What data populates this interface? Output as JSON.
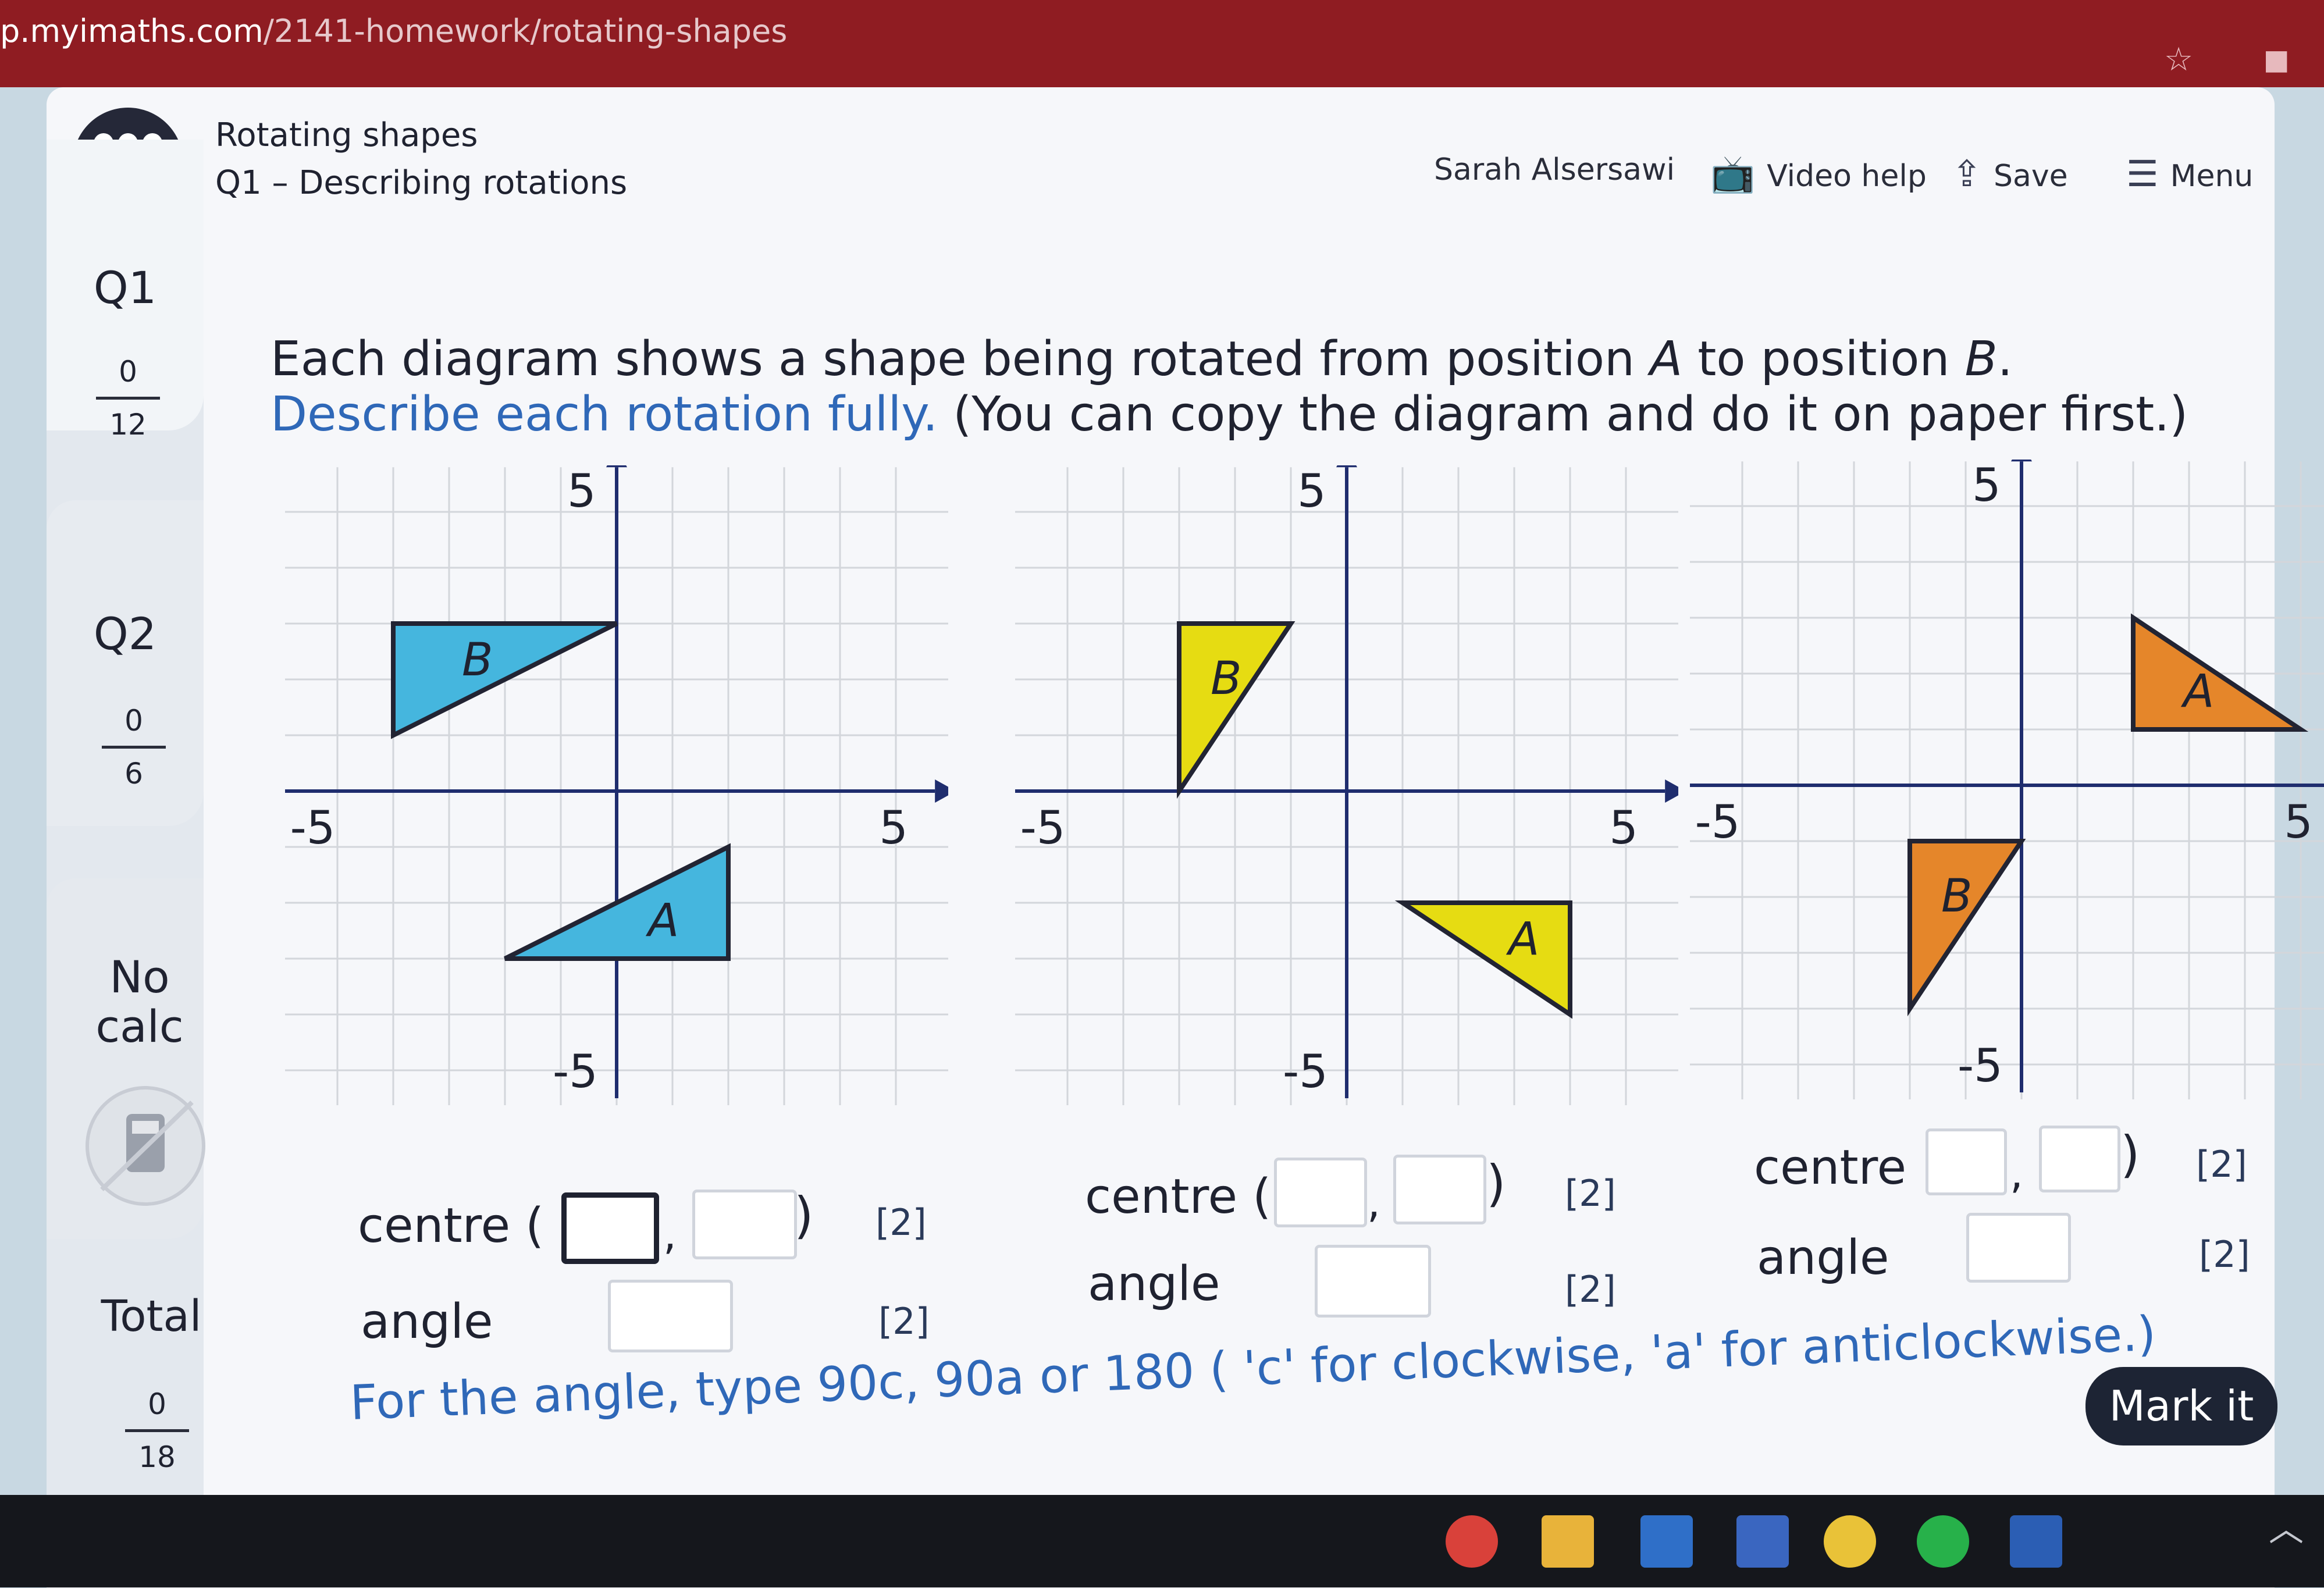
{
  "browser": {
    "url_domain": "p.myimaths.com",
    "url_path": "/2141-homework/rotating-shapes"
  },
  "header": {
    "title": "Rotating shapes",
    "subtitle": "Q1 – Describing rotations",
    "user": "Sarah Alsersawi",
    "video_help": "Video help",
    "save": "Save",
    "menu": "Menu"
  },
  "sidebar": {
    "q1": {
      "label": "Q1",
      "score": "0",
      "total": "12"
    },
    "q2": {
      "label": "Q2",
      "score": "0",
      "total": "6"
    },
    "calc_line1": "No",
    "calc_line2": "calc",
    "total": {
      "label": "Total",
      "score": "0",
      "total": "18"
    }
  },
  "instructions": {
    "line1_a": "Each diagram shows a shape being rotated from position ",
    "line1_A": "A",
    "line1_b": " to position ",
    "line1_B": "B",
    "line1_c": ".",
    "line2_link": "Describe each rotation fully.",
    "line2_rest": " (You can copy the diagram and do it on paper first.)"
  },
  "diagrams": [
    {
      "axis_labels": {
        "top": "5",
        "bottom": "-5",
        "left": "-5",
        "right": "5"
      },
      "color": "#45b6de",
      "shapes": [
        {
          "label": "B",
          "points": [
            [
              -4,
              3
            ],
            [
              0,
              3
            ],
            [
              -4,
              1
            ]
          ]
        },
        {
          "label": "A",
          "points": [
            [
              -2,
              -3
            ],
            [
              2,
              -3
            ],
            [
              2,
              -1
            ]
          ]
        }
      ]
    },
    {
      "axis_labels": {
        "top": "5",
        "bottom": "-5",
        "left": "-5",
        "right": "5"
      },
      "color": "#e6dc12",
      "shapes": [
        {
          "label": "B",
          "points": [
            [
              -3,
              3
            ],
            [
              -1,
              3
            ],
            [
              -3,
              0
            ]
          ]
        },
        {
          "label": "A",
          "points": [
            [
              1,
              -2
            ],
            [
              4,
              -2
            ],
            [
              4,
              -4
            ]
          ]
        }
      ]
    },
    {
      "axis_labels": {
        "top": "5",
        "bottom": "-5",
        "left": "-5",
        "right": "5"
      },
      "color": "#e5862a",
      "shapes": [
        {
          "label": "A",
          "points": [
            [
              2,
              3
            ],
            [
              2,
              1
            ],
            [
              5,
              1
            ]
          ]
        },
        {
          "label": "B",
          "points": [
            [
              -2,
              -1
            ],
            [
              0,
              -1
            ],
            [
              -2,
              -4
            ]
          ]
        }
      ]
    }
  ],
  "answers": {
    "centre_label": "centre (",
    "close_paren": ")",
    "comma": ",",
    "angle_label": "angle",
    "marks": "[2]"
  },
  "note": "For the angle, type 90c, 90a or 180 ( 'c' for clockwise, 'a' for anticlockwise.)",
  "mark_button": "Mark it"
}
